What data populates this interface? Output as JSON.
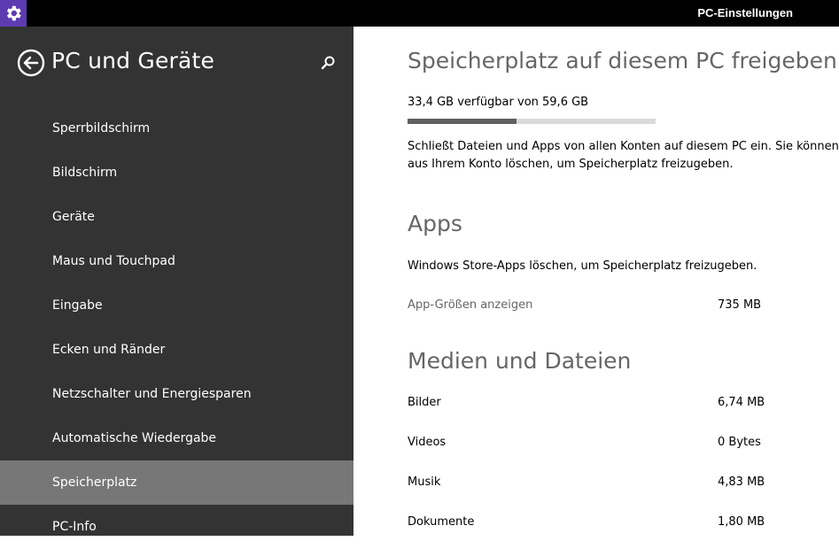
{
  "window": {
    "title": "PC-Einstellungen",
    "accent_color": "#5d3bb0",
    "app_icon": "gear-icon"
  },
  "sidebar": {
    "title": "PC und Geräte",
    "back_icon": "back-arrow-icon",
    "search_icon": "search-icon",
    "items": [
      {
        "label": "Sperrbildschirm"
      },
      {
        "label": "Bildschirm"
      },
      {
        "label": "Geräte"
      },
      {
        "label": "Maus und Touchpad"
      },
      {
        "label": "Eingabe"
      },
      {
        "label": "Ecken und Ränder"
      },
      {
        "label": "Netzschalter und Energiesparen"
      },
      {
        "label": "Automatische Wiedergabe"
      },
      {
        "label": "Speicherplatz",
        "selected": true
      },
      {
        "label": "PC-Info"
      }
    ]
  },
  "main": {
    "storage_heading": "Speicherplatz auf diesem PC freigeben",
    "storage_summary": "33,4 GB verfügbar von 59,6 GB",
    "storage_used_fraction": 0.44,
    "storage_desc_line1": "Schließt Dateien und Apps von allen Konten auf diesem PC ein. Sie können Da",
    "storage_desc_line2": "aus Ihrem Konto löschen, um Speicherplatz freizugeben.",
    "apps_heading": "Apps",
    "apps_desc": "Windows Store-Apps löschen, um Speicherplatz freizugeben.",
    "app_sizes_link": "App-Größen anzeigen",
    "app_sizes_value": "735 MB",
    "media_heading": "Medien und Dateien",
    "media_rows": [
      {
        "label": "Bilder",
        "value": "6,74 MB"
      },
      {
        "label": "Videos",
        "value": "0 Bytes"
      },
      {
        "label": "Musik",
        "value": "4,83 MB"
      },
      {
        "label": "Dokumente",
        "value": "1,80 MB"
      }
    ]
  }
}
